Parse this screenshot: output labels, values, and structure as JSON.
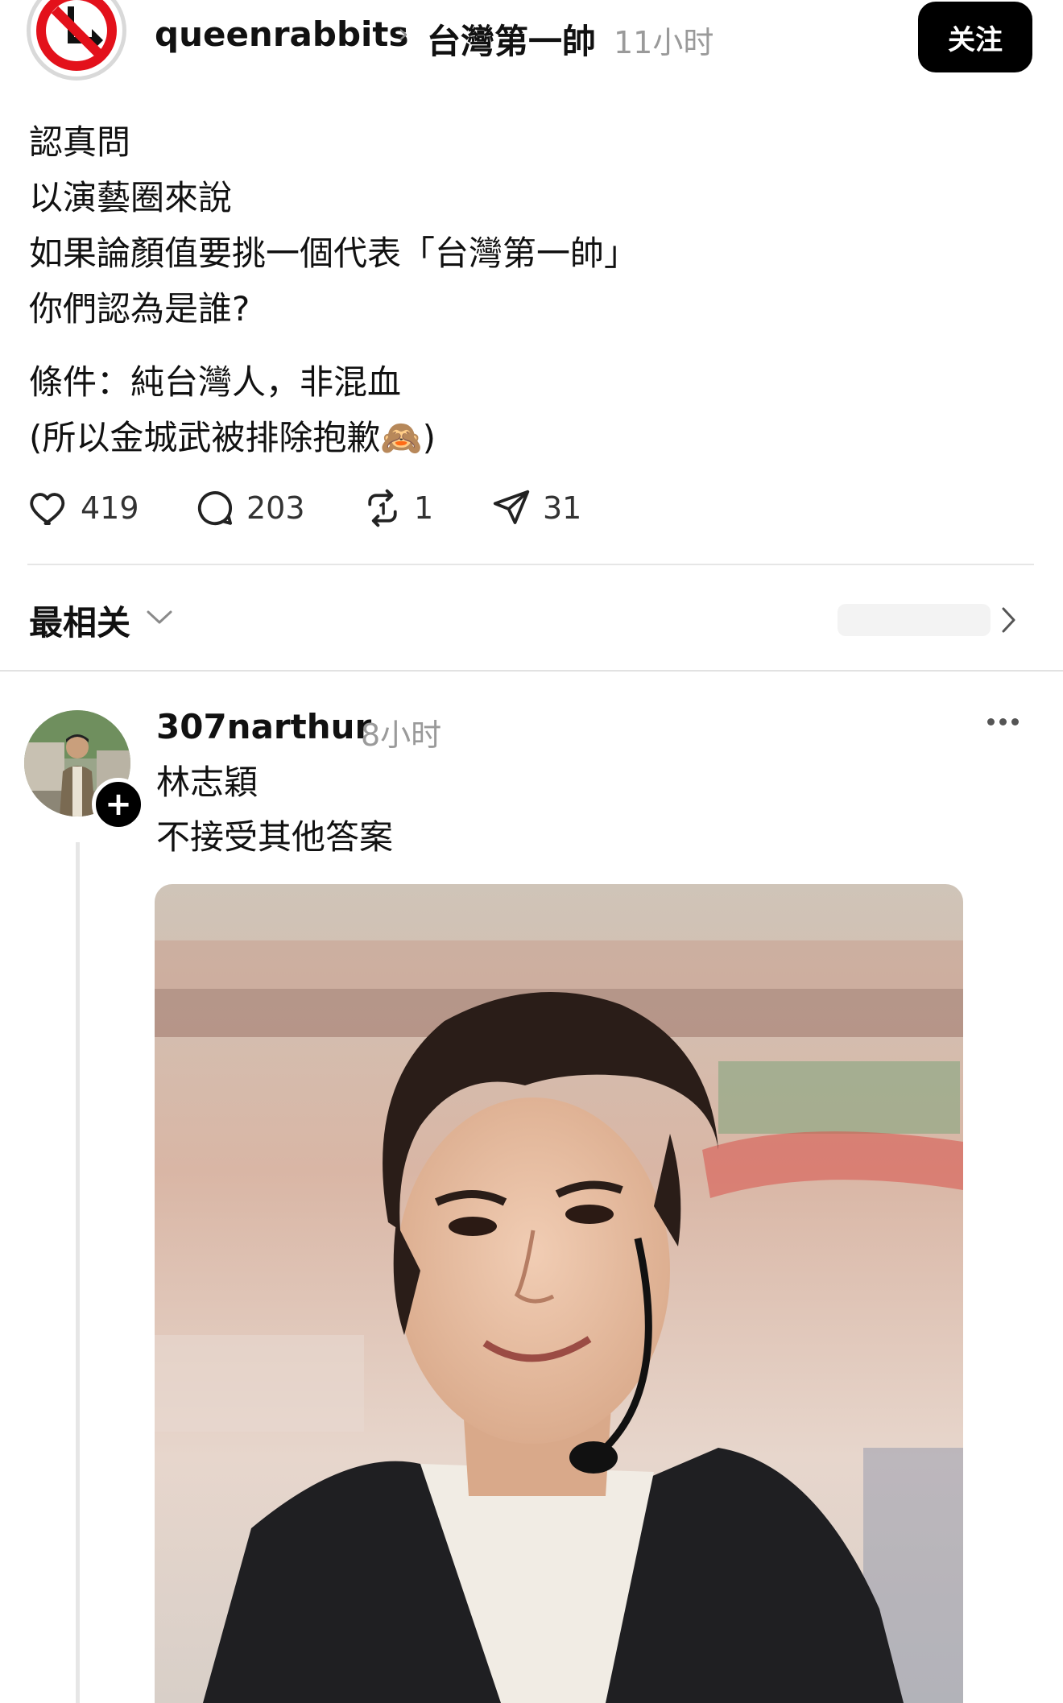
{
  "post": {
    "handle": "queenrabbits",
    "breadcrumb_sep": "›",
    "topic": "台灣第一帥",
    "time": "11小时",
    "follow_label": "关注",
    "lines": [
      "認真問",
      "以演藝圈來說",
      "如果論顏值要挑一個代表「台灣第一帥」",
      "你們認為是誰?"
    ],
    "lines2": [
      "條件：純台灣人，非混血",
      "(所以金城武被排除抱歉🙈)"
    ],
    "stats": {
      "likes": "419",
      "comments": "203",
      "reposts": "1",
      "shares": "31"
    }
  },
  "sort": {
    "label": "最相关"
  },
  "reply": {
    "username": "307narthur",
    "time": "8小时",
    "lines": [
      "林志穎",
      "不接受其他答案"
    ]
  },
  "icons": {
    "op_avatar": "no-left-turn-sign-icon",
    "like": "heart-icon",
    "comment": "comment-bubble-icon",
    "repost": "repost-icon",
    "share": "send-icon",
    "more": "more-dots-icon"
  },
  "colors": {
    "follow_bg": "#000000",
    "sign_red": "#e3111b",
    "muted": "#9a9a9a"
  }
}
